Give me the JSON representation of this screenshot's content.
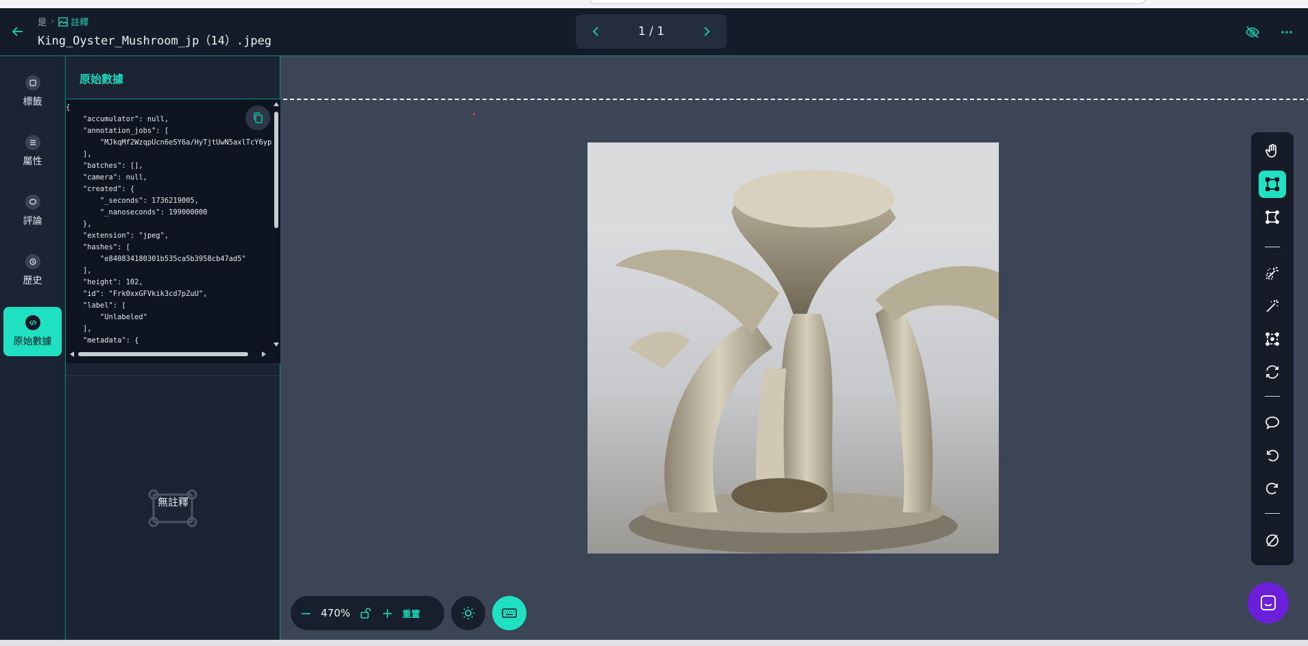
{
  "header": {
    "breadcrumb_root": "是",
    "breadcrumb_current": "註釋",
    "filename": "King_Oyster_Mushroom_jp（14）.jpeg",
    "pager_text": "1 / 1",
    "icons": [
      "back-arrow-icon",
      "eye-off-icon",
      "more-horizontal-icon"
    ]
  },
  "leftnav": {
    "items": [
      {
        "label": "標籤",
        "icon": "tag-icon"
      },
      {
        "label": "屬性",
        "icon": "list-icon"
      },
      {
        "label": "評論",
        "icon": "comment-icon"
      },
      {
        "label": "歷史",
        "icon": "history-icon"
      },
      {
        "label": "原始數據",
        "icon": "code-icon",
        "active": true
      }
    ]
  },
  "rawpanel": {
    "title": "原始數據",
    "json_text": "{\n    \"accumulator\": null,\n    \"annotation_jobs\": [\n        \"MJkqMf2WzqpUcn6eSY6a/HyTjtUwN5axlTcY6yp\n    ],\n    \"batches\": [],\n    \"camera\": null,\n    \"created\": {\n        \"_seconds\": 1736219005,\n        \"_nanoseconds\": 199000000\n    },\n    \"extension\": \"jpeg\",\n    \"hashes\": [\n        \"e840834180301b535ca5b3958cb47ad5\"\n    ],\n    \"height\": 102,\n    \"id\": \"Frk0xxGFVkik3cd7pZuU\",\n    \"label\": [\n        \"Unlabeled\"\n    ],\n    \"metadata\": {\n        \"no\": \"metadata\"",
    "no_annotation": "無註釋"
  },
  "zoom": {
    "value": "470%",
    "minus": "−",
    "plus": "+",
    "reset_label": "重置"
  },
  "colors": {
    "accent": "#1fe0c1",
    "bg_dark": "#1b2433",
    "canvas_bg": "#3b4556",
    "chat_fab": "#6c1fd8"
  },
  "toolbar_right": {
    "tools": [
      "pan-hand-icon",
      "bounding-box-icon",
      "polygon-icon",
      "magic-select-icon",
      "magic-wand-icon",
      "keypoints-icon",
      "refresh-tool-icon",
      "comment-icon",
      "undo-icon",
      "redo-icon",
      "clear-icon"
    ]
  }
}
